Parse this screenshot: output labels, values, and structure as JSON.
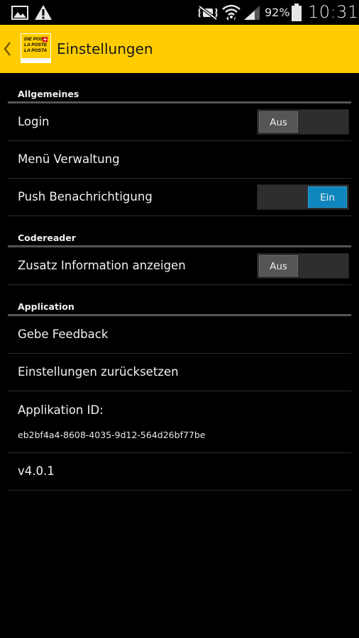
{
  "status_bar": {
    "left_icons": [
      "image-icon",
      "warning-icon"
    ],
    "right_icons": [
      "mute-icon",
      "wifi-icon",
      "signal-icon",
      "battery-icon"
    ],
    "battery": "92%",
    "time": "10:31"
  },
  "action_bar": {
    "title": "Einstellungen",
    "logo_lines": [
      "DIE POST",
      "LA POSTE",
      "LA POSTA"
    ],
    "colors": {
      "background": "#ffcc00",
      "accent": "#e2001a"
    }
  },
  "settings": {
    "general": {
      "header": "Allgemeines",
      "login": {
        "label": "Login",
        "toggle": "Aus"
      },
      "menu": {
        "label": "Menü Verwaltung"
      },
      "push": {
        "label": "Push Benachrichtigung",
        "toggle": "Ein"
      }
    },
    "codereader": {
      "header": "Codereader",
      "extra_info": {
        "label": "Zusatz Information anzeigen",
        "toggle": "Aus"
      }
    },
    "application": {
      "header": "Application",
      "feedback": {
        "label": "Gebe Feedback"
      },
      "reset": {
        "label": "Einstellungen zurücksetzen"
      },
      "app_id": {
        "label": "Applikation ID:",
        "value": "eb2bf4a4-8608-4035-9d12-564d26bf77be"
      },
      "version": {
        "label": "v4.0.1"
      }
    }
  },
  "colors": {
    "toggle_on": "#0f87be",
    "toggle_off": "#555555",
    "divider": "#555555"
  }
}
